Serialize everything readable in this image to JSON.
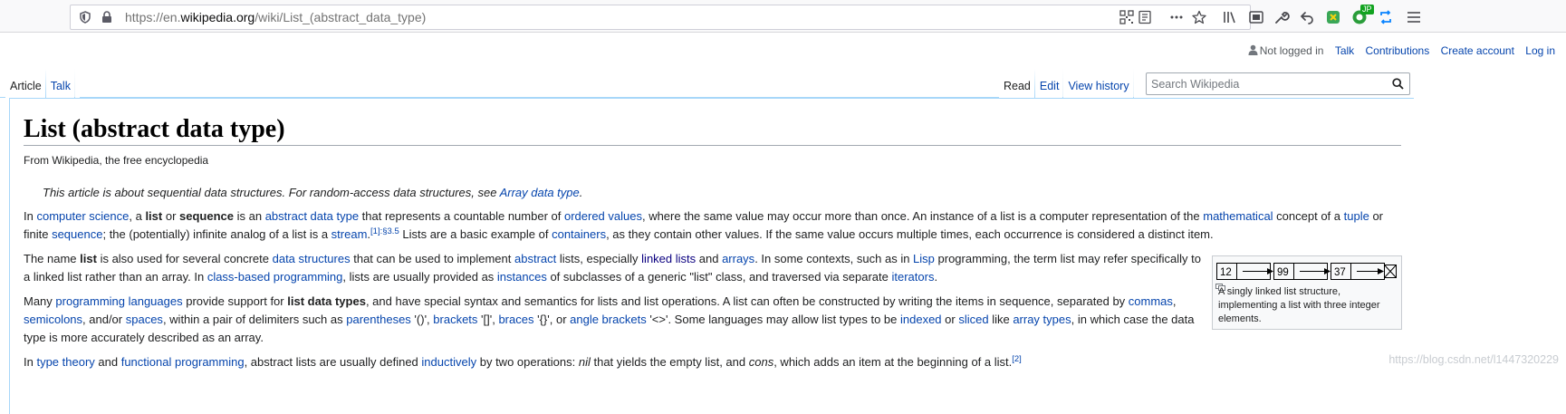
{
  "browser": {
    "url_prefix": "https://en.",
    "url_domain": "wikipedia.org",
    "url_path": "/wiki/List_(abstract_data_type)",
    "extension_badge": "JP"
  },
  "personal_tools": {
    "not_logged_in": "Not logged in",
    "talk": "Talk",
    "contributions": "Contributions",
    "create_account": "Create account",
    "log_in": "Log in"
  },
  "tabs": {
    "article": "Article",
    "talk": "Talk",
    "read": "Read",
    "edit": "Edit",
    "view_history": "View history"
  },
  "search": {
    "placeholder": "Search Wikipedia"
  },
  "article": {
    "title": "List (abstract data type)",
    "from": "From Wikipedia, the free encyclopedia",
    "hatnote": {
      "text": "This article is about sequential data structures. For random-access data structures, see ",
      "link": "Array data type",
      "end": "."
    },
    "p1": {
      "l1": [
        "In ",
        "computer science",
        ", a ",
        "list",
        " or ",
        "sequence",
        " is an ",
        "abstract data type",
        " that represents a countable number of ",
        "ordered values",
        ", where the same value may occur more than once. An instance of a list is a computer representation of the ",
        "mathematical",
        " concept of a ",
        "tuple",
        " or"
      ],
      "l2": [
        "finite ",
        "sequence",
        "; the (potentially) infinite analog of a list is a ",
        "stream",
        ".",
        "[1]:§3.5",
        " Lists are a basic example of ",
        "containers",
        ", as they contain other values. If the same value occurs multiple times, each occurrence is considered a distinct item."
      ]
    },
    "p2": {
      "l1": [
        "The name ",
        "list",
        " is also used for several concrete ",
        "data structures",
        " that can be used to implement ",
        "abstract",
        " lists, especially ",
        "linked lists",
        " and ",
        "arrays",
        ". In some contexts, such as in ",
        "Lisp",
        " programming, the term list may refer specifically to"
      ],
      "l2": [
        "a linked list rather than an array. In ",
        "class-based programming",
        ", lists are usually provided as ",
        "instances",
        " of subclasses of a generic \"list\" class, and traversed via separate ",
        "iterators",
        "."
      ]
    },
    "p3": {
      "l1": [
        "Many ",
        "programming languages",
        " provide support for ",
        "list data types",
        ", and have special syntax and semantics for lists and list operations. A list can often be constructed by writing the items in sequence, separated by ",
        "commas",
        ","
      ],
      "l2": [
        "semicolons",
        ", and/or ",
        "spaces",
        ", within a pair of delimiters such as ",
        "parentheses",
        " '()', ",
        "brackets",
        " '[]', ",
        "braces",
        " '{}', or ",
        "angle brackets",
        " '<>'. Some languages may allow list types to be ",
        "indexed",
        " or ",
        "sliced",
        " like ",
        "array types",
        ", in which case the data"
      ],
      "l3": [
        "type is more accurately described as an array."
      ]
    },
    "p4": {
      "l1": [
        "In ",
        "type theory",
        " and ",
        "functional programming",
        ", abstract lists are usually defined ",
        "inductively",
        " by two operations: ",
        "nil",
        " that yields the empty list, and ",
        "cons",
        ", which adds an item at the beginning of a list.",
        "[2]"
      ]
    },
    "thumb": {
      "nodes": [
        "12",
        "99",
        "37"
      ],
      "caption": "A singly linked list structure, implementing a list with three integer elements."
    }
  },
  "watermark": "https://blog.csdn.net/l1447320229"
}
